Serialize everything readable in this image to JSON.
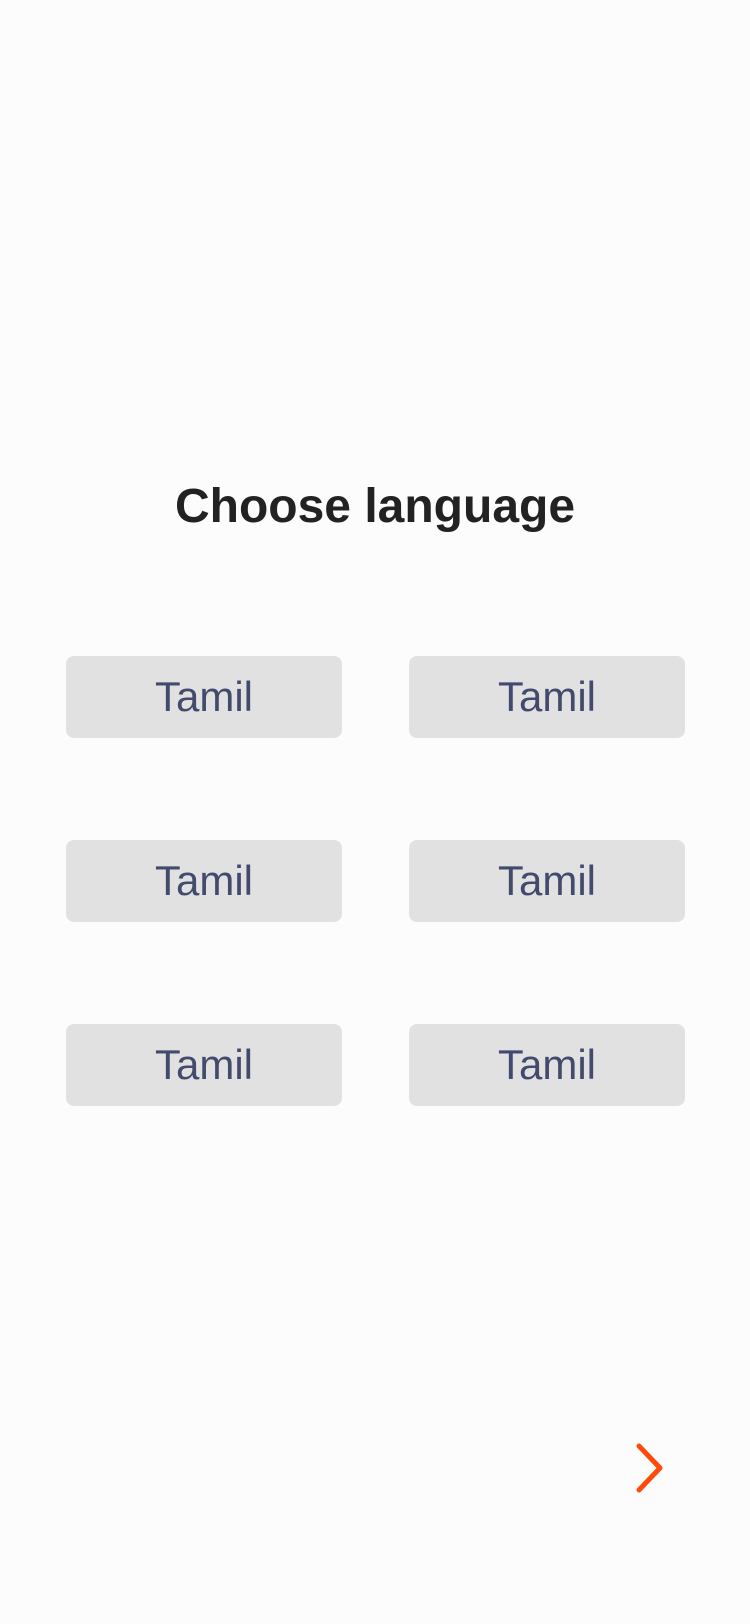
{
  "header": {
    "title": "Choose language"
  },
  "languages": [
    {
      "label": "Tamil"
    },
    {
      "label": "Tamil"
    },
    {
      "label": "Tamil"
    },
    {
      "label": "Tamil"
    },
    {
      "label": "Tamil"
    },
    {
      "label": "Tamil"
    }
  ],
  "next": {
    "icon": "chevron-right-icon",
    "color": "#ff4b0a"
  },
  "colors": {
    "background": "#fcfcfc",
    "button_bg": "#e1e1e2",
    "button_text": "#434b6d",
    "title_text": "#222222",
    "accent": "#ff4b0a"
  }
}
